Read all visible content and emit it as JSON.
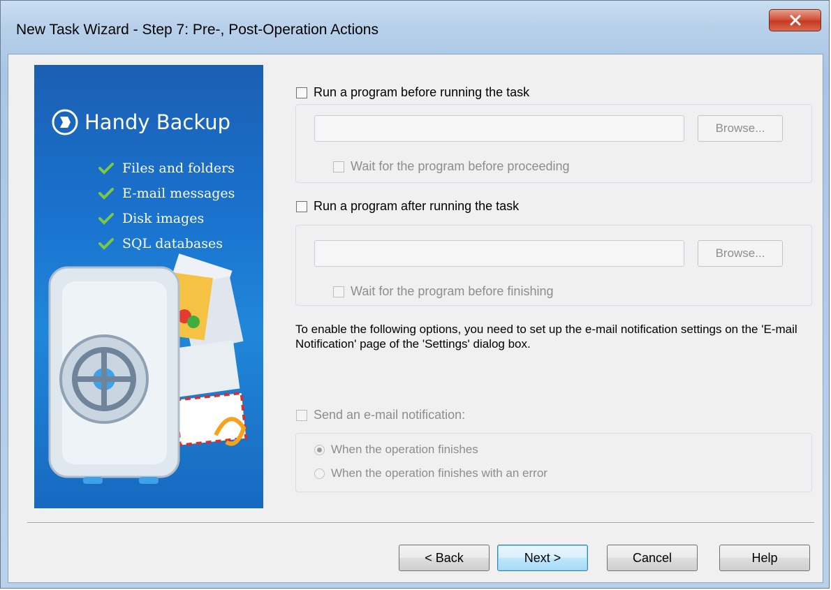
{
  "window": {
    "title": "New Task Wizard - Step 7: Pre-, Post-Operation Actions",
    "close_glyph": "x"
  },
  "banner": {
    "brand": "Handy Backup",
    "features": [
      "Files and folders",
      "E-mail messages",
      "Disk images",
      "SQL databases"
    ]
  },
  "pre_action": {
    "checkbox_label": "Run a program before running the task",
    "checked": false,
    "path_value": "",
    "browse_label": "Browse...",
    "wait_label": "Wait for the program before proceeding"
  },
  "post_action": {
    "checkbox_label": "Run a program after running the task",
    "checked": false,
    "path_value": "",
    "browse_label": "Browse...",
    "wait_label": "Wait for the program before finishing"
  },
  "info_text": "To enable the following options, you need to set up the e-mail notification settings on the 'E-mail Notification' page of the 'Settings' dialog box.",
  "email": {
    "checkbox_label": "Send an e-mail notification:",
    "option_finish": "When the operation finishes",
    "option_error": "When the operation finishes with an error",
    "selected": "When the operation finishes"
  },
  "buttons": {
    "back": "< Back",
    "next": "Next >",
    "cancel": "Cancel",
    "help": "Help"
  },
  "colors": {
    "banner_blue": "#1a73cf",
    "check_green": "#7ac943",
    "close_red": "#c43a22"
  }
}
